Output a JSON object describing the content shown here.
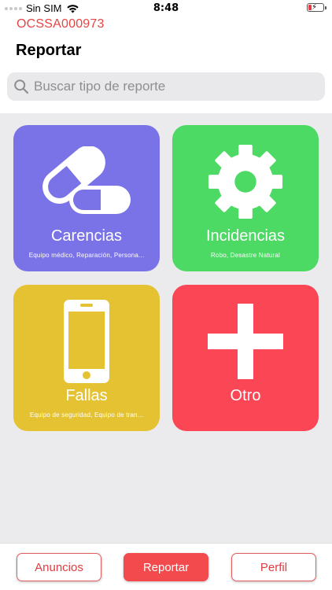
{
  "status_bar": {
    "carrier": "Sin SIM",
    "time": "8:48",
    "icons": [
      "signal-dots-icon",
      "wifi-icon",
      "battery-charging-icon"
    ]
  },
  "header": {
    "org_code": "OCSSA000973",
    "title": "Reportar"
  },
  "search": {
    "placeholder": "Buscar tipo de reporte",
    "icon": "search-icon"
  },
  "tiles": [
    {
      "label": "Carencias",
      "subtitle": "Equipo médico, Reparación, Persona...",
      "color": "#7a72e7",
      "icon": "pill-icon"
    },
    {
      "label": "Incidencias",
      "subtitle": "Robo, Desastre Natural",
      "color": "#4cd964",
      "icon": "gear-icon"
    },
    {
      "label": "Fallas",
      "subtitle": "Equipo de seguridad, Equipo de tran...",
      "color": "#e5c232",
      "icon": "phone-icon"
    },
    {
      "label": "Otro",
      "subtitle": "",
      "color": "#fb4656",
      "icon": "plus-icon"
    }
  ],
  "bottom_nav": {
    "anuncios": "Anuncios",
    "reportar": "Reportar",
    "perfil": "Perfil"
  },
  "colors": {
    "accent": "#f24a4d",
    "org_code": "#e64545",
    "grid_background": "#ebebee"
  }
}
